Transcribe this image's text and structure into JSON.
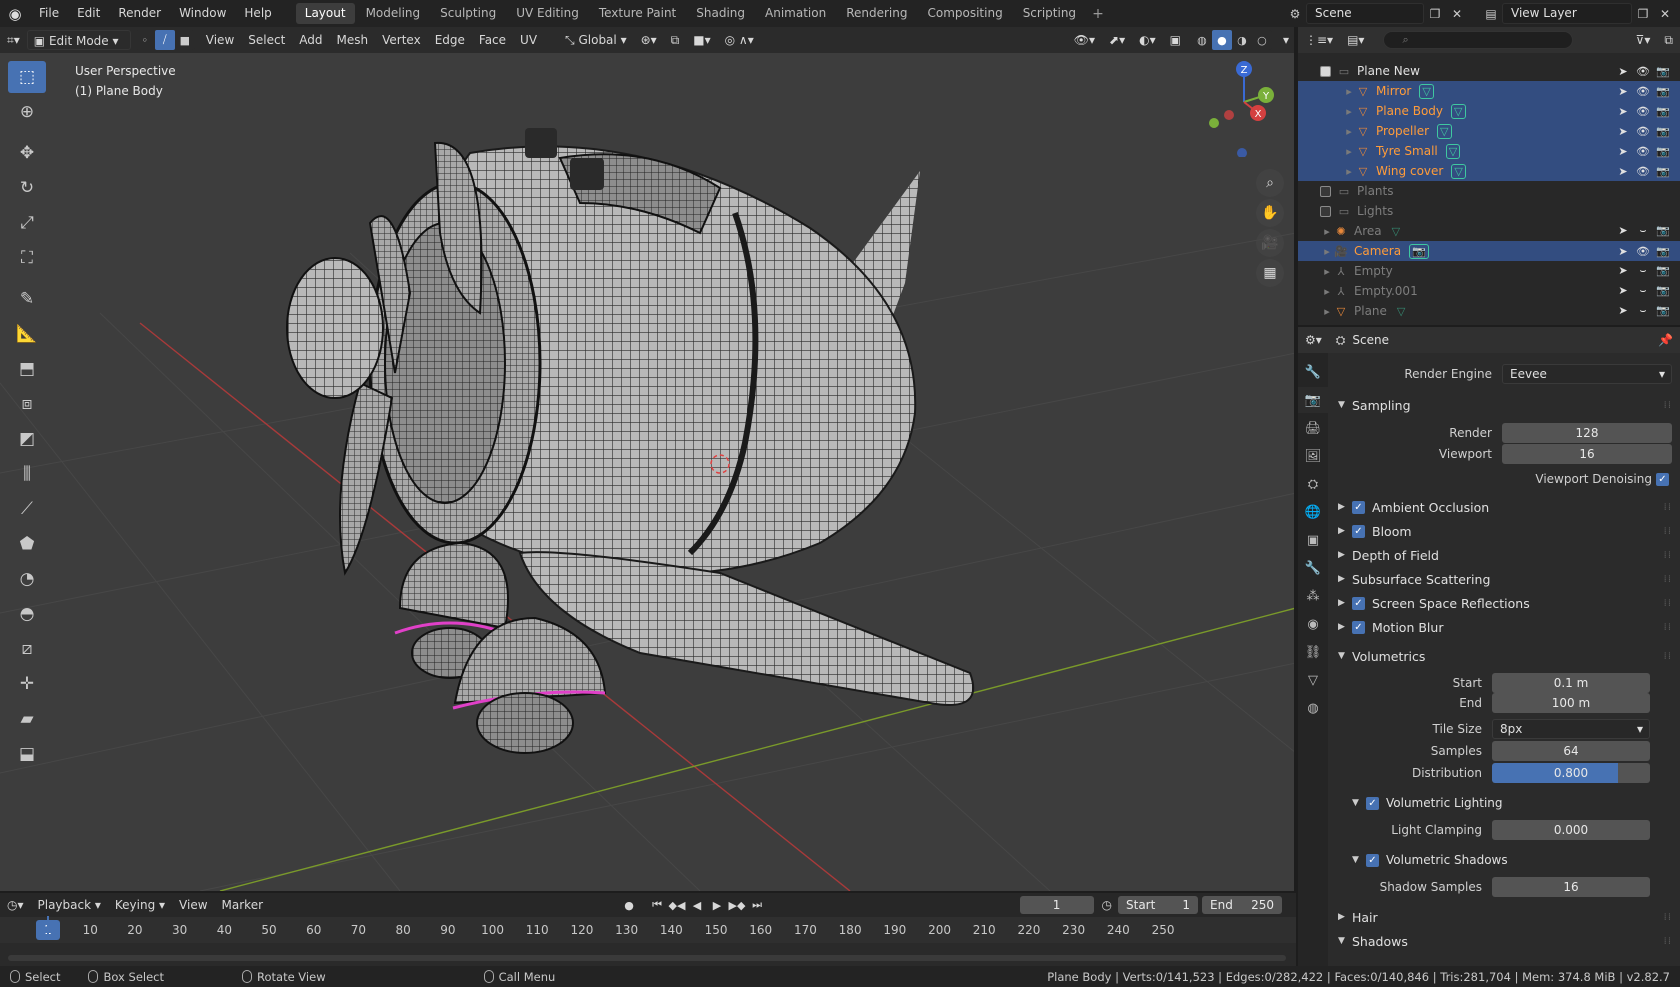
{
  "topbar": {
    "menus": [
      "File",
      "Edit",
      "Render",
      "Window",
      "Help"
    ],
    "workspaces": [
      "Layout",
      "Modeling",
      "Sculpting",
      "UV Editing",
      "Texture Paint",
      "Shading",
      "Animation",
      "Rendering",
      "Compositing",
      "Scripting"
    ],
    "active_workspace": "Layout",
    "scene_name": "Scene",
    "view_layer": "View Layer"
  },
  "viewport": {
    "mode": "Edit Mode",
    "menus": [
      "View",
      "Select",
      "Add",
      "Mesh",
      "Vertex",
      "Edge",
      "Face",
      "UV"
    ],
    "transform_orientation": "Global",
    "perspective_label": "User Perspective",
    "object_label": "(1) Plane Body",
    "gizmo_axes": {
      "x": "X",
      "y": "Y",
      "z": "Z"
    }
  },
  "timeline": {
    "menus": [
      "Playback",
      "Keying",
      "View",
      "Marker"
    ],
    "current_frame": "1",
    "start_label": "Start",
    "start_value": "1",
    "end_label": "End",
    "end_value": "250",
    "ruler_badge": "1",
    "ruler_ticks": [
      "10",
      "20",
      "30",
      "40",
      "50",
      "60",
      "70",
      "80",
      "90",
      "100",
      "110",
      "120",
      "130",
      "140",
      "150",
      "160",
      "170",
      "180",
      "190",
      "200",
      "210",
      "220",
      "230",
      "240",
      "250"
    ]
  },
  "statusbar": {
    "select": "Select",
    "box_select": "Box Select",
    "rotate_view": "Rotate View",
    "call_menu": "Call Menu",
    "stats": "Plane Body | Verts:0/141,523 | Edges:0/282,422 | Faces:0/140,846 | Tris:281,704 | Mem: 374.8 MiB | v2.82.7"
  },
  "outliner": {
    "rows": [
      {
        "name": "Plane New",
        "type": "collection",
        "checked": true,
        "selected": false,
        "dim": false
      },
      {
        "name": "Mirror",
        "type": "mesh",
        "selected": true,
        "dim": false
      },
      {
        "name": "Plane Body",
        "type": "mesh",
        "selected": true,
        "dim": false
      },
      {
        "name": "Propeller",
        "type": "mesh",
        "selected": true,
        "dim": false
      },
      {
        "name": "Tyre Small",
        "type": "mesh",
        "selected": true,
        "dim": false
      },
      {
        "name": "Wing cover",
        "type": "mesh",
        "selected": true,
        "dim": false
      },
      {
        "name": "Plants",
        "type": "collection",
        "checked": false,
        "selected": false,
        "dim": true
      },
      {
        "name": "Lights",
        "type": "collection",
        "checked": false,
        "selected": false,
        "dim": true
      },
      {
        "name": "Area",
        "type": "light",
        "selected": false,
        "dim": true
      },
      {
        "name": "Camera",
        "type": "camera",
        "selected": true,
        "dim": false
      },
      {
        "name": "Empty",
        "type": "empty",
        "selected": false,
        "dim": true
      },
      {
        "name": "Empty.001",
        "type": "empty",
        "selected": false,
        "dim": true
      },
      {
        "name": "Plane",
        "type": "mesh",
        "selected": false,
        "dim": true
      }
    ]
  },
  "properties": {
    "context": "Scene",
    "render_engine_label": "Render Engine",
    "render_engine": "Eevee",
    "sampling": {
      "title": "Sampling",
      "render_label": "Render",
      "render": "128",
      "viewport_label": "Viewport",
      "viewport": "16",
      "denoise_label": "Viewport Denoising"
    },
    "panels": [
      {
        "title": "Ambient Occlusion",
        "checkbox": true
      },
      {
        "title": "Bloom",
        "checkbox": true
      },
      {
        "title": "Depth of Field",
        "checkbox": false
      },
      {
        "title": "Subsurface Scattering",
        "checkbox": false
      },
      {
        "title": "Screen Space Reflections",
        "checkbox": true
      },
      {
        "title": "Motion Blur",
        "checkbox": true
      }
    ],
    "volumetrics": {
      "title": "Volumetrics",
      "start_label": "Start",
      "start": "0.1 m",
      "end_label": "End",
      "end": "100 m",
      "tile_label": "Tile Size",
      "tile": "8px",
      "samples_label": "Samples",
      "samples": "64",
      "distribution_label": "Distribution",
      "distribution": "0.800",
      "distribution_fraction": 0.8,
      "lighting_title": "Volumetric Lighting",
      "clamp_label": "Light Clamping",
      "clamp": "0.000",
      "shadows_title": "Volumetric Shadows",
      "shadow_samples_label": "Shadow Samples",
      "shadow_samples": "16"
    },
    "hair": "Hair",
    "shadows": "Shadows"
  },
  "colors": {
    "accent": "#4772b3",
    "selection_row": "#334d80",
    "mesh_orange": "#e8883a",
    "edge_magenta": "#e040c8"
  }
}
